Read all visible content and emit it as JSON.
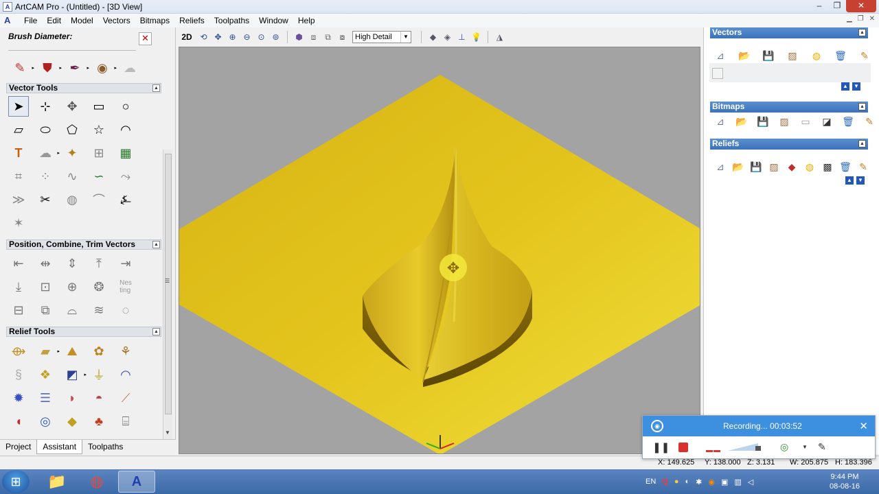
{
  "window": {
    "title": "ArtCAM Pro - (Untitled) - [3D View]",
    "minimize": "–",
    "maximize": "❐",
    "close": "✕"
  },
  "menu": {
    "items": [
      "File",
      "Edit",
      "Model",
      "Vectors",
      "Bitmaps",
      "Reliefs",
      "Toolpaths",
      "Window",
      "Help"
    ]
  },
  "left_panel": {
    "brush_label": "Brush Diameter:",
    "close_glyph": "✕",
    "sections": {
      "vector_tools": "Vector Tools",
      "position_combine": "Position, Combine, Trim Vectors",
      "relief_tools": "Relief Tools"
    },
    "tabs": [
      "Project",
      "Assistant",
      "Toolpaths"
    ]
  },
  "view_toolbar": {
    "mode_2d": "2D",
    "detail_level": "High Detail"
  },
  "right_panel": {
    "vectors": "Vectors",
    "bitmaps": "Bitmaps",
    "reliefs": "Reliefs"
  },
  "status": {
    "x": "X: 149.625",
    "y": "Y: 138.000",
    "z": "Z: 3.131",
    "w": "W: 205.875",
    "h": "H: 183.396"
  },
  "recording": {
    "text": "Recording... 00:03:52"
  },
  "taskbar": {
    "lang": "EN",
    "time": "9:44 PM",
    "date": "08-08-16"
  },
  "colors": {
    "relief": "#e6c01a",
    "viewport_bg": "#a3a3a3",
    "panel_header": "#3c72ba"
  }
}
